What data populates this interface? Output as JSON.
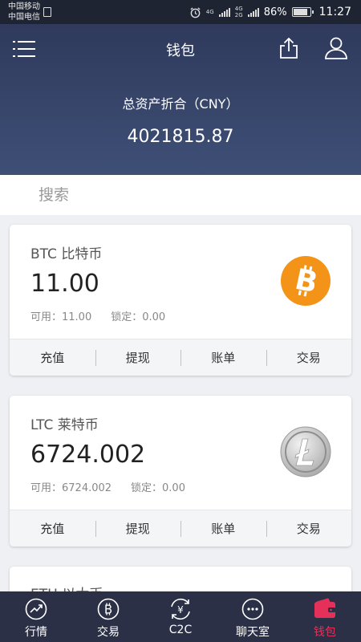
{
  "status_bar": {
    "carrier_1": "中国移动",
    "carrier_2": "中国电信",
    "network_1": "4G",
    "network_2": "4G",
    "network_2b": "2G",
    "battery": "86%",
    "time": "11:27"
  },
  "header": {
    "title": "钱包",
    "total_label": "总资产折合（CNY）",
    "total_value": "4021815.87"
  },
  "search": {
    "placeholder": "搜索",
    "value": ""
  },
  "wallets": [
    {
      "name": "BTC 比特币",
      "amount": "11.00",
      "available": "可用：11.00",
      "locked": "锁定：0.00",
      "icon": "bitcoin-icon",
      "icon_color": "#f39419",
      "actions": [
        "充值",
        "提现",
        "账单",
        "交易"
      ]
    },
    {
      "name": "LTC 莱特币",
      "amount": "6724.002",
      "available": "可用：6724.002",
      "locked": "锁定：0.00",
      "icon": "litecoin-icon",
      "icon_color": "#b8b8b8",
      "actions": [
        "充值",
        "提现",
        "账单",
        "交易"
      ]
    },
    {
      "name": "ETH 以太币"
    }
  ],
  "tabbar": {
    "tabs": [
      {
        "label": "行情",
        "icon": "market-trend-icon"
      },
      {
        "label": "交易",
        "icon": "bitcoin-trade-icon"
      },
      {
        "label": "C2C",
        "icon": "yuan-exchange-icon"
      },
      {
        "label": "聊天室",
        "icon": "chat-bubble-icon"
      },
      {
        "label": "钱包",
        "icon": "wallet-icon"
      }
    ],
    "active_index": 4,
    "active_color": "#e5315a"
  }
}
